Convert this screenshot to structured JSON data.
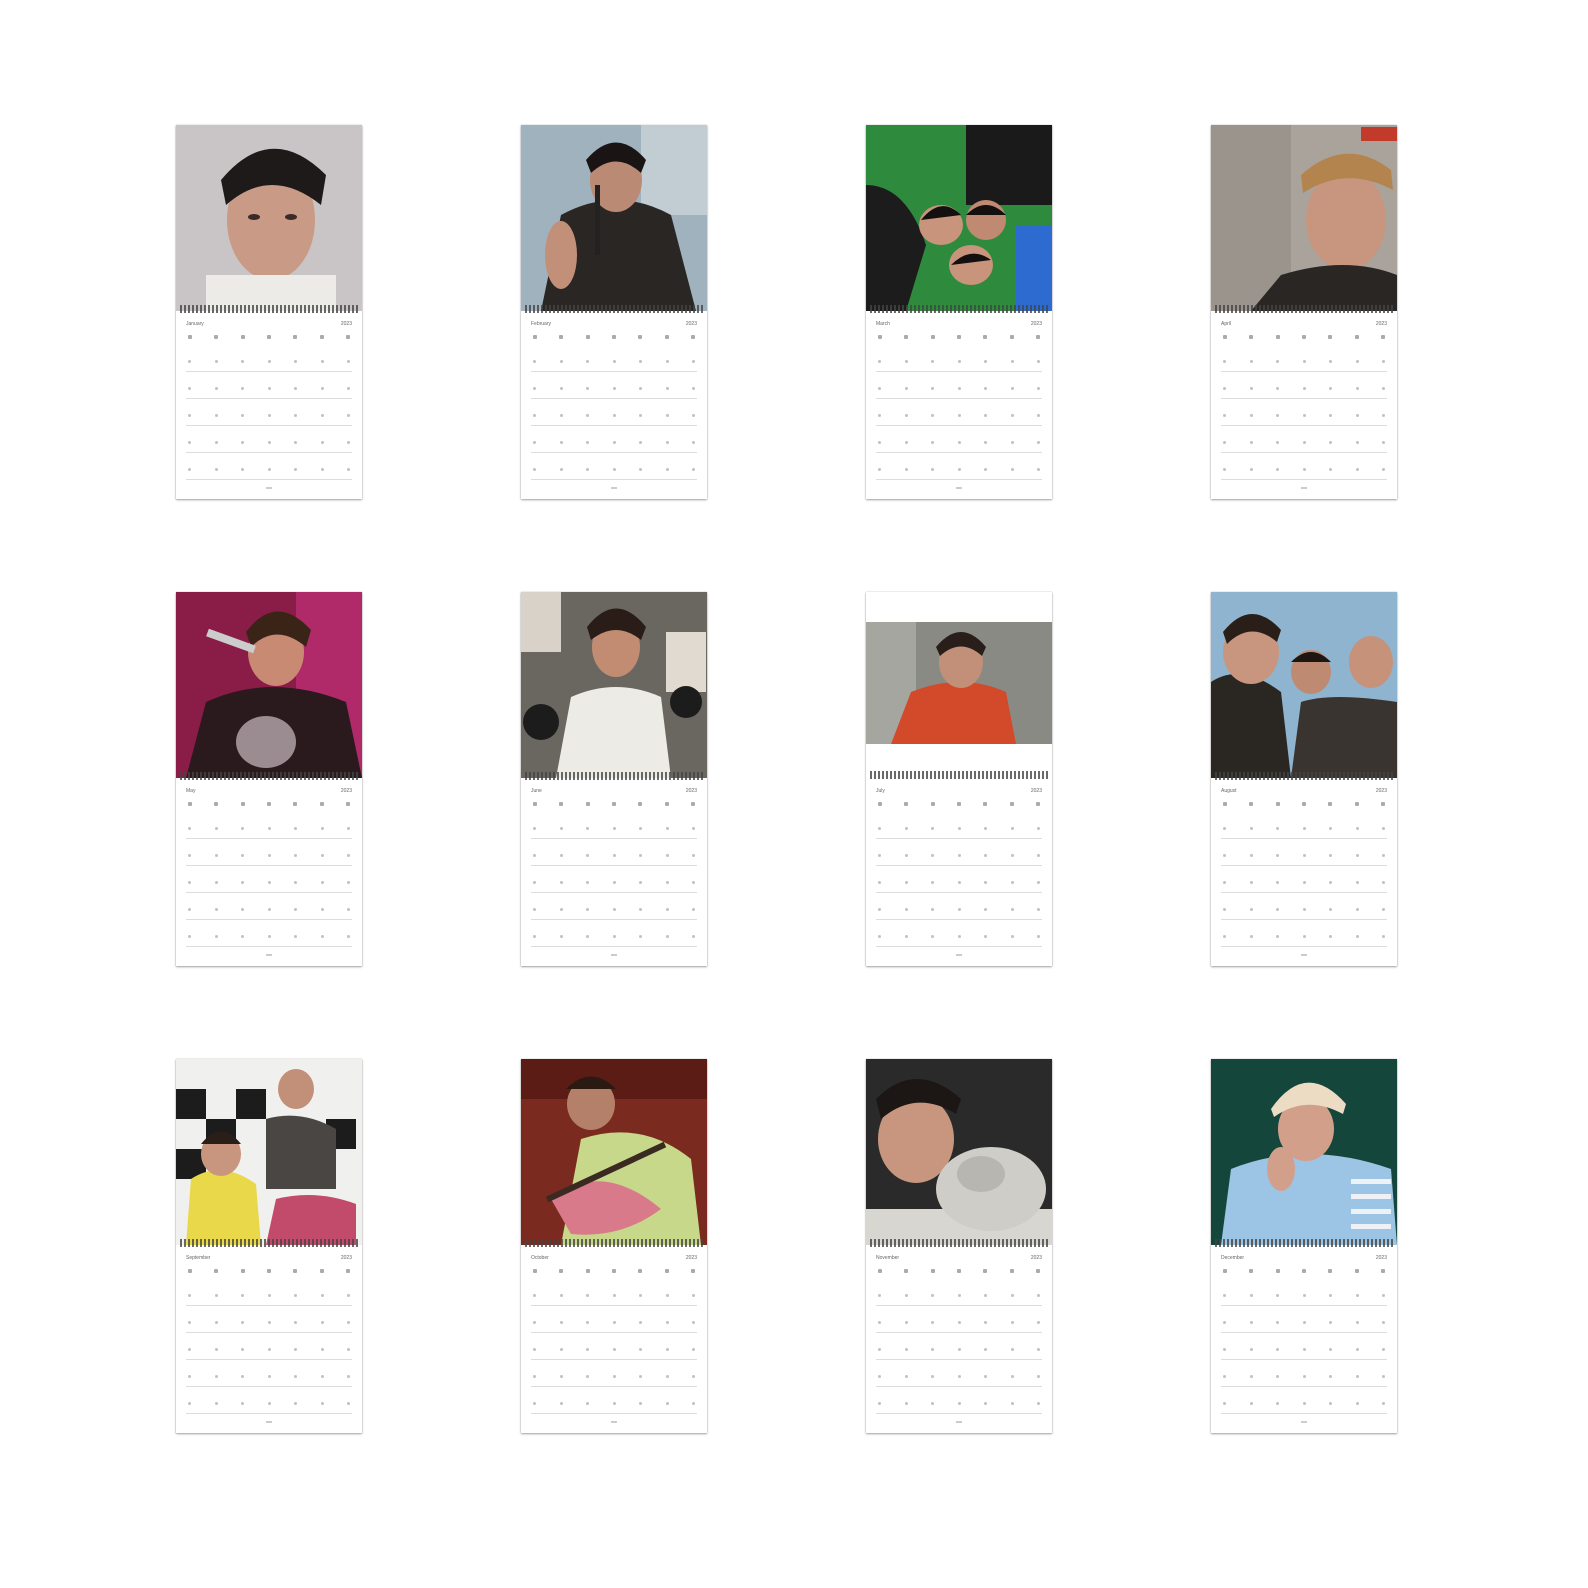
{
  "calendar": {
    "year": "2023",
    "months": [
      {
        "name": "January",
        "photo": "portrait-dark-hair-grey-background"
      },
      {
        "name": "February",
        "photo": "singer-at-microphone"
      },
      {
        "name": "March",
        "photo": "band-lying-on-green-grass"
      },
      {
        "name": "April",
        "photo": "selfie-with-cap"
      },
      {
        "name": "May",
        "photo": "singer-pink-stage-light"
      },
      {
        "name": "June",
        "photo": "white-tshirt-collage-background"
      },
      {
        "name": "July",
        "photo": "red-shirt-outdoor"
      },
      {
        "name": "August",
        "photo": "group-low-angle-sky"
      },
      {
        "name": "September",
        "photo": "band-checkered-floor"
      },
      {
        "name": "October",
        "photo": "guitarist-red-light"
      },
      {
        "name": "November",
        "photo": "sleeping-with-cat"
      },
      {
        "name": "December",
        "photo": "beanie-striped-sweater"
      }
    ]
  }
}
